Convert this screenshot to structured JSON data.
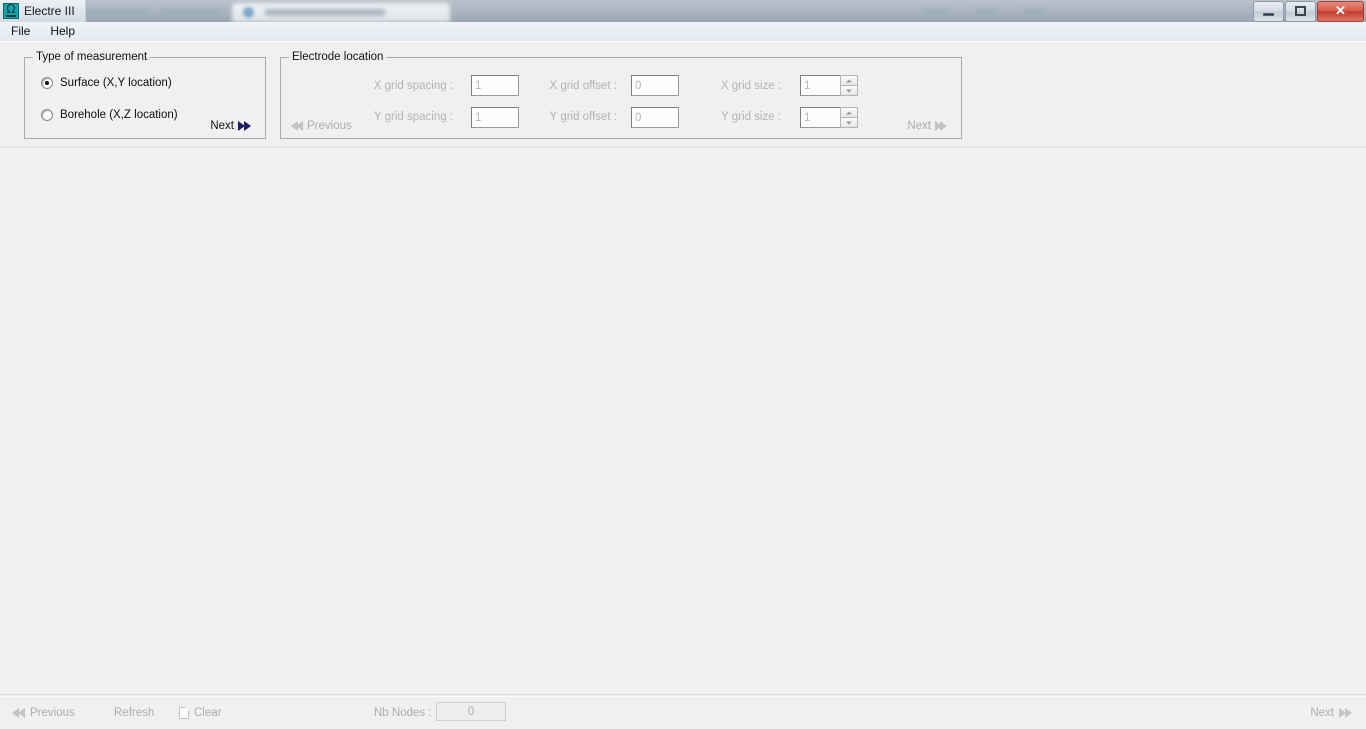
{
  "window": {
    "title": "Electre III",
    "icon": "omega-app-icon",
    "controls": {
      "minimize": "minimize-button",
      "restore": "restore-button",
      "close_glyph": "✕"
    }
  },
  "menubar": {
    "items": [
      {
        "label": "File"
      },
      {
        "label": "Help"
      }
    ]
  },
  "measurement_panel": {
    "title": "Type of measurement",
    "options": [
      {
        "label": "Surface (X,Y location)",
        "selected": true
      },
      {
        "label": "Borehole (X,Z location)",
        "selected": false
      }
    ],
    "next_label": "Next"
  },
  "electrode_panel": {
    "title": "Electrode location",
    "previous_label": "Previous",
    "next_label": "Next",
    "fields": [
      {
        "label": "X grid spacing :",
        "value": "1"
      },
      {
        "label": "Y grid spacing :",
        "value": "1"
      },
      {
        "label": "X grid offset :",
        "value": "0"
      },
      {
        "label": "Y grid offset :",
        "value": "0"
      },
      {
        "label": "X grid size :",
        "value": "1"
      },
      {
        "label": "Y grid size :",
        "value": "1"
      }
    ]
  },
  "bottombar": {
    "previous_label": "Previous",
    "refresh_label": "Refresh",
    "clear_label": "Clear",
    "nb_nodes_label": "Nb Nodes :",
    "nb_nodes_value": "0",
    "next_label": "Next"
  },
  "colors": {
    "window_background": "#f0f0f0",
    "accent_icon": "#17a3a8",
    "close_button": "#c0392b",
    "arrow_navy": "#1b1b66",
    "disabled_text": "#adadad"
  }
}
